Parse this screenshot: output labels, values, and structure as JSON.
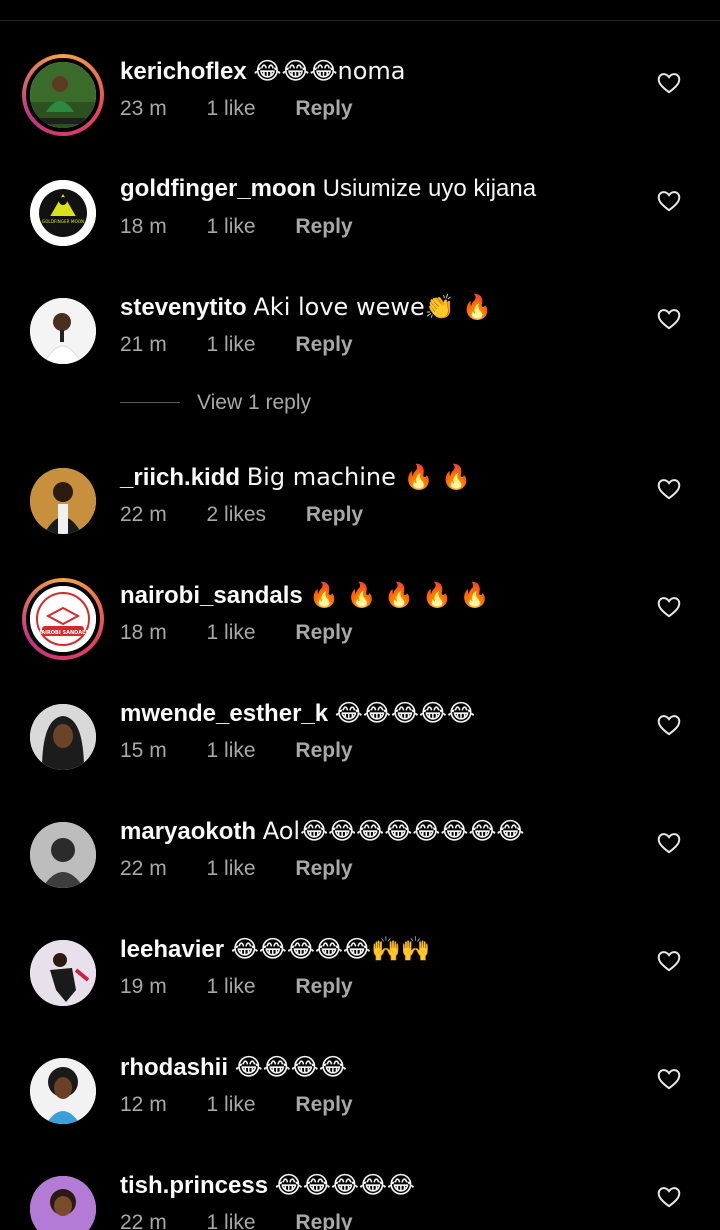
{
  "view_replies_label": "View 1 reply",
  "colors": {
    "background": "#000000",
    "text": "#f5f5f5",
    "meta": "#a8a8a8",
    "divider": "#262626"
  },
  "comments": [
    {
      "username": "kerichoflex",
      "text": "😂😂😂noma",
      "time": "23 m",
      "likes": "1 like",
      "reply": "Reply",
      "avatar_icon": "profile-photo-green"
    },
    {
      "username": "goldfinger_moon",
      "text": "Usiumize uyo kijana",
      "time": "18 m",
      "likes": "1 like",
      "reply": "Reply",
      "avatar_icon": "goldfinger-moon-logo",
      "logo_text": "GOLDFINGER MOON"
    },
    {
      "username": "stevenytito",
      "text": "Aki love wewe👏 🔥",
      "time": "21 m",
      "likes": "1 like",
      "reply": "Reply",
      "avatar_icon": "profile-photo-white"
    },
    {
      "username": "_riich.kidd",
      "text": "Big machine 🔥 🔥",
      "time": "22 m",
      "likes": "2 likes",
      "reply": "Reply",
      "avatar_icon": "profile-photo-brown"
    },
    {
      "username": "nairobi_sandals",
      "text": "🔥 🔥 🔥 🔥 🔥",
      "time": "18 m",
      "likes": "1 like",
      "reply": "Reply",
      "avatar_icon": "nairobi-sandals-logo",
      "logo_text": "NAIROBI SANDALS"
    },
    {
      "username": "mwende_esther_k",
      "text": "😂😂😂😂😂",
      "time": "15 m",
      "likes": "1 like",
      "reply": "Reply",
      "avatar_icon": "profile-photo-hijab"
    },
    {
      "username": "maryaokoth",
      "text": "Aol😂😂😂😂😂😂😂😂",
      "time": "22 m",
      "likes": "1 like",
      "reply": "Reply",
      "avatar_icon": "profile-photo-grayscale"
    },
    {
      "username": "leehavier",
      "text": "😂😂😂😂😂🙌🙌",
      "time": "19 m",
      "likes": "1 like",
      "reply": "Reply",
      "avatar_icon": "profile-photo-dance"
    },
    {
      "username": "rhodashii",
      "text": "😂😂😂😂",
      "time": "12 m",
      "likes": "1 like",
      "reply": "Reply",
      "avatar_icon": "profile-photo-curly"
    },
    {
      "username": "tish.princess",
      "text": "😂😂😂😂😂",
      "time": "22 m",
      "likes": "1 like",
      "reply": "Reply",
      "avatar_icon": "profile-photo-purple"
    }
  ]
}
